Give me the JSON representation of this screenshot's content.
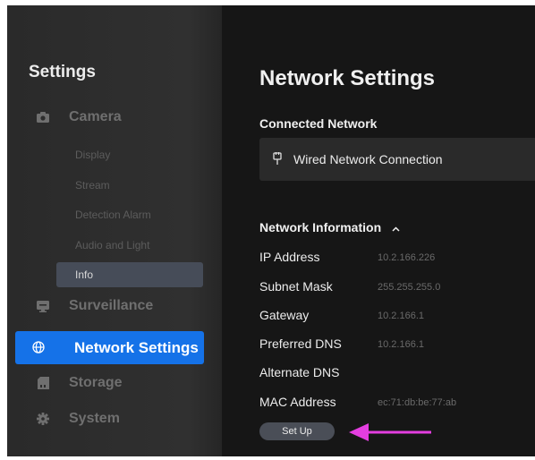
{
  "sidebar": {
    "title": "Settings",
    "camera": {
      "label": "Camera",
      "icon": "camera-icon"
    },
    "camera_subitems": [
      "Display",
      "Stream",
      "Detection Alarm",
      "Audio and Light",
      "Info"
    ],
    "surveillance": {
      "label": "Surveillance",
      "icon": "monitor-icon"
    },
    "network": {
      "label": "Network Settings",
      "icon": "globe-icon"
    },
    "storage": {
      "label": "Storage",
      "icon": "storage-icon"
    },
    "system": {
      "label": "System",
      "icon": "gear-icon"
    }
  },
  "main": {
    "title": "Network Settings",
    "connected_heading": "Connected Network",
    "connection_name": "Wired Network Connection",
    "info_heading": "Network Information",
    "rows": [
      {
        "label": "IP Address",
        "value": "10.2.166.226"
      },
      {
        "label": "Subnet Mask",
        "value": "255.255.255.0"
      },
      {
        "label": "Gateway",
        "value": "10.2.166.1"
      },
      {
        "label": "Preferred DNS",
        "value": "10.2.166.1"
      },
      {
        "label": "Alternate DNS",
        "value": ""
      },
      {
        "label": "MAC Address",
        "value": "ec:71:db:be:77:ab"
      }
    ],
    "setup_label": "Set Up"
  },
  "colors": {
    "accent": "#1572e8",
    "annotation_arrow": "#e43ee0",
    "background": "#161616",
    "sidebar": "#2c2c2c"
  }
}
